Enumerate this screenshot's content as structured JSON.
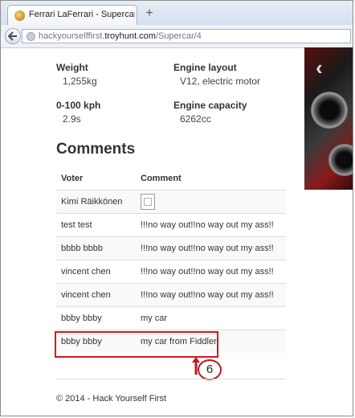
{
  "browser": {
    "tab_title": "Ferrari LaFerrari - Supercar Sho...",
    "new_tab_glyph": "+",
    "url_prefix": "hackyourselffirst.",
    "url_domain": "troyhunt.com",
    "url_path": "/Supercar/4"
  },
  "specs": [
    {
      "label": "Weight",
      "value": "1,255kg"
    },
    {
      "label": "Engine layout",
      "value": "V12, electric motor"
    },
    {
      "label": "0-100 kph",
      "value": "2.9s"
    },
    {
      "label": "Engine capacity",
      "value": "6262cc"
    }
  ],
  "comments": {
    "heading": "Comments",
    "headers": {
      "voter": "Voter",
      "comment": "Comment"
    },
    "rows": [
      {
        "voter": "Kimi Räikkönen",
        "comment": ""
      },
      {
        "voter": "test test",
        "comment": "!!!no way out!!no way out my ass!!"
      },
      {
        "voter": "bbbb bbbb",
        "comment": "!!!no way out!!no way out my ass!!"
      },
      {
        "voter": "vincent chen",
        "comment": "!!!no way out!!no way out my ass!!"
      },
      {
        "voter": "vincent chen",
        "comment": "!!!no way out!!no way out my ass!!"
      },
      {
        "voter": "bbby bbby",
        "comment": "my car"
      },
      {
        "voter": "bbby bbby",
        "comment": "my car from Fiddler"
      }
    ]
  },
  "annotation": {
    "number": "6",
    "color": "#c4161e"
  },
  "footer": "© 2014 - Hack Yourself First",
  "icons": {
    "back": "back-arrow-icon",
    "site": "globe-icon",
    "broken_image": "broken-image-icon"
  }
}
